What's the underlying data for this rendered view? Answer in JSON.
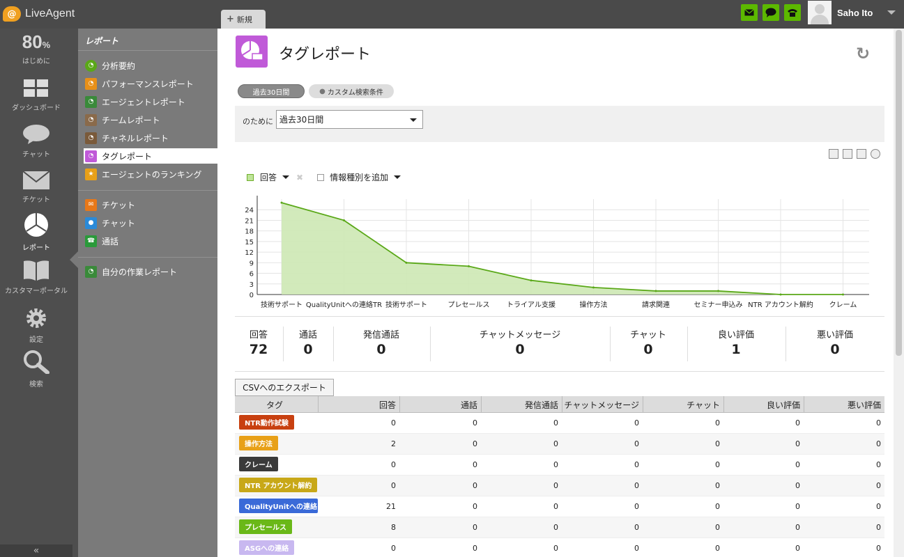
{
  "app": {
    "name": "LiveAgent",
    "new_tab": "新規"
  },
  "user": {
    "name": "Saho Ito"
  },
  "colors": {
    "accent_green": "#5cb800",
    "nav_bg": "#4e4e4e",
    "submenu_bg": "#7a7a7a",
    "chart_fill": "#cde8b4",
    "chart_line": "#5aa818"
  },
  "leftnav": {
    "progress": {
      "value": "80",
      "unit": "%",
      "label": "はじめに"
    },
    "items": [
      {
        "label": "ダッシュボード",
        "icon": "dashboard-icon"
      },
      {
        "label": "チャット",
        "icon": "chat-bubble-icon"
      },
      {
        "label": "チケット",
        "icon": "envelope-icon"
      },
      {
        "label": "レポート",
        "icon": "pie-chart-icon"
      },
      {
        "label": "カスタマーポータル",
        "icon": "book-icon"
      },
      {
        "label": "設定",
        "icon": "gear-icon"
      },
      {
        "label": "検索",
        "icon": "magnifier-icon"
      }
    ],
    "collapse": "«"
  },
  "submenu": {
    "title": "レポート",
    "items": [
      {
        "label": "分析要約",
        "color": "#5aa818"
      },
      {
        "label": "パフォーマンスレポート",
        "color": "#e89018"
      },
      {
        "label": "エージェントレポート",
        "color": "#3a8a3a"
      },
      {
        "label": "チームレポート",
        "color": "#8a6a4a"
      },
      {
        "label": "チャネルレポート",
        "color": "#7a5a3a"
      },
      {
        "label": "タグレポート",
        "color": "#c05ad8"
      },
      {
        "label": "エージェントのランキング",
        "color": "#e8a018"
      },
      {
        "label": "チケット",
        "color": "#e87818"
      },
      {
        "label": "チャット",
        "color": "#2a8ad8"
      },
      {
        "label": "通話",
        "color": "#2a9a3a"
      },
      {
        "label": "自分の作業レポート",
        "color": "#3a8a3a"
      }
    ]
  },
  "page": {
    "title": "タグレポート",
    "filters": {
      "period": "過去30日間",
      "custom": "カスタム検索条件"
    },
    "for_label": "のために",
    "for_value": "過去30日間",
    "legend": {
      "series": "回答",
      "add": "情報種別を追加"
    },
    "csv_button": "CSVへのエクスポート"
  },
  "chart_data": {
    "type": "area",
    "categories": [
      "技術サポート",
      "QualityUnitへの連絡TR",
      "技術サポート",
      "プレセールス",
      "トライアル支援",
      "操作方法",
      "請求関連",
      "セミナー申込み",
      "NTR アカウント解約",
      "クレーム"
    ],
    "series": [
      {
        "name": "回答",
        "values": [
          26,
          21,
          9,
          8,
          4,
          2,
          1,
          1,
          0,
          0
        ]
      }
    ],
    "yticks": [
      "0",
      "3",
      "6",
      "9",
      "12",
      "15",
      "18",
      "21",
      "24"
    ],
    "ylim": [
      0,
      27
    ],
    "grid": true
  },
  "stats": [
    {
      "label": "回答",
      "value": "72"
    },
    {
      "label": "通話",
      "value": "0"
    },
    {
      "label": "発信通話",
      "value": "0"
    },
    {
      "label": "チャットメッセージ",
      "value": "0"
    },
    {
      "label": "チャット",
      "value": "0"
    },
    {
      "label": "良い評価",
      "value": "1"
    },
    {
      "label": "悪い評価",
      "value": "0"
    }
  ],
  "table": {
    "headers": [
      "タグ",
      "回答",
      "通話",
      "発信通話",
      "チャットメッセージ",
      "チャット",
      "良い評価",
      "悪い評価"
    ],
    "rows": [
      {
        "tag": "NTR動作試験",
        "color": "#c84010",
        "cells": [
          "0",
          "0",
          "0",
          "0",
          "0",
          "0",
          "0"
        ]
      },
      {
        "tag": "操作方法",
        "color": "#e8a018",
        "cells": [
          "2",
          "0",
          "0",
          "0",
          "0",
          "0",
          "0"
        ]
      },
      {
        "tag": "クレーム",
        "color": "#3a3a3a",
        "cells": [
          "0",
          "0",
          "0",
          "0",
          "0",
          "0",
          "0"
        ]
      },
      {
        "tag": "NTR アカウント解約",
        "color": "#c8a818",
        "cells": [
          "0",
          "0",
          "0",
          "0",
          "0",
          "0",
          "0"
        ]
      },
      {
        "tag": "QualityUnitへの連絡",
        "color": "#3a6ad8",
        "cells": [
          "21",
          "0",
          "0",
          "0",
          "0",
          "0",
          "0"
        ]
      },
      {
        "tag": "プレセールス",
        "color": "#6ab818",
        "cells": [
          "8",
          "0",
          "0",
          "0",
          "0",
          "0",
          "0"
        ]
      },
      {
        "tag": "ASGへの連絡",
        "color": "#c8b8f0",
        "cells": [
          "0",
          "0",
          "0",
          "0",
          "0",
          "0",
          "0"
        ]
      }
    ]
  }
}
